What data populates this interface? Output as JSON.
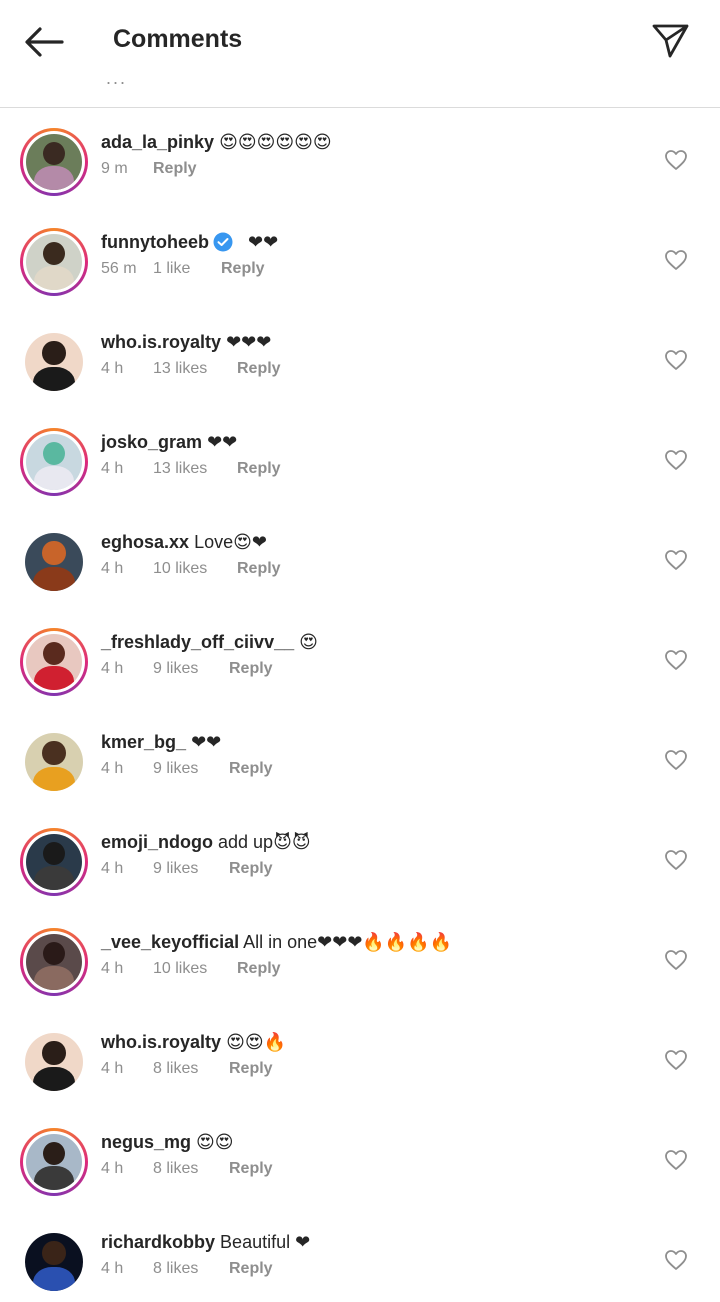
{
  "header": {
    "title": "Comments",
    "back_icon": "arrow-left-icon",
    "send_icon": "paper-plane-icon",
    "ellipsis": "..."
  },
  "colors": {
    "text": "#262626",
    "muted": "#8e8e8e",
    "verified": "#3897f0",
    "divider": "#dbdbdb"
  },
  "comments": [
    {
      "username": "ada_la_pinky",
      "text": "😍😍😍😍😍😍",
      "time": "9 m",
      "likes": "",
      "reply": "Reply",
      "verified": false
    },
    {
      "username": "funnytoheeb",
      "text": "❤❤",
      "time": "56 m",
      "likes": "1 like",
      "reply": "Reply",
      "verified": true
    },
    {
      "username": "who.is.royalty",
      "text": "❤❤❤",
      "time": "4 h",
      "likes": "13 likes",
      "reply": "Reply",
      "verified": false
    },
    {
      "username": "josko_gram",
      "text": "❤❤",
      "time": "4 h",
      "likes": "13 likes",
      "reply": "Reply",
      "verified": false
    },
    {
      "username": "eghosa.xx",
      "text": "Love😍❤",
      "time": "4 h",
      "likes": "10 likes",
      "reply": "Reply",
      "verified": false
    },
    {
      "username": "_freshlady_off_ciivv__",
      "text": "😍",
      "time": "4 h",
      "likes": "9 likes",
      "reply": "Reply",
      "verified": false
    },
    {
      "username": "kmer_bg_",
      "text": "❤❤",
      "time": "4 h",
      "likes": "9 likes",
      "reply": "Reply",
      "verified": false
    },
    {
      "username": "emoji_ndogo",
      "text": "add up😈😈",
      "time": "4 h",
      "likes": "9 likes",
      "reply": "Reply",
      "verified": false
    },
    {
      "username": "_vee_keyofficial",
      "text": "All in one❤❤❤🔥🔥🔥🔥",
      "time": "4 h",
      "likes": "10 likes",
      "reply": "Reply",
      "verified": false
    },
    {
      "username": "who.is.royalty",
      "text": "😍😍🔥",
      "time": "4 h",
      "likes": "8 likes",
      "reply": "Reply",
      "verified": false
    },
    {
      "username": "negus_mg",
      "text": "😍😍",
      "time": "4 h",
      "likes": "8 likes",
      "reply": "Reply",
      "verified": false
    },
    {
      "username": "richardkobby",
      "text": "Beautiful ❤",
      "time": "4 h",
      "likes": "8 likes",
      "reply": "Reply",
      "verified": false
    }
  ]
}
